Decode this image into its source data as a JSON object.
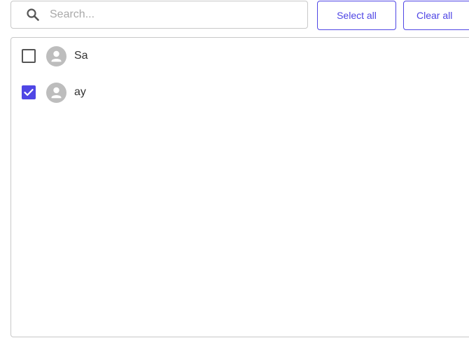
{
  "search": {
    "placeholder": "Search...",
    "value": ""
  },
  "actions": {
    "select_all_label": "Select all",
    "clear_all_label": "Clear all"
  },
  "list": {
    "items": [
      {
        "label": "Sa",
        "checked": false
      },
      {
        "label": "ay",
        "checked": true
      }
    ]
  },
  "colors": {
    "accent": "#4f46e5",
    "avatar_bg": "#bdbdbd",
    "border": "#c8c8c8"
  },
  "icons": {
    "search": "search-icon",
    "avatar": "person-icon",
    "check": "checkmark-icon"
  }
}
